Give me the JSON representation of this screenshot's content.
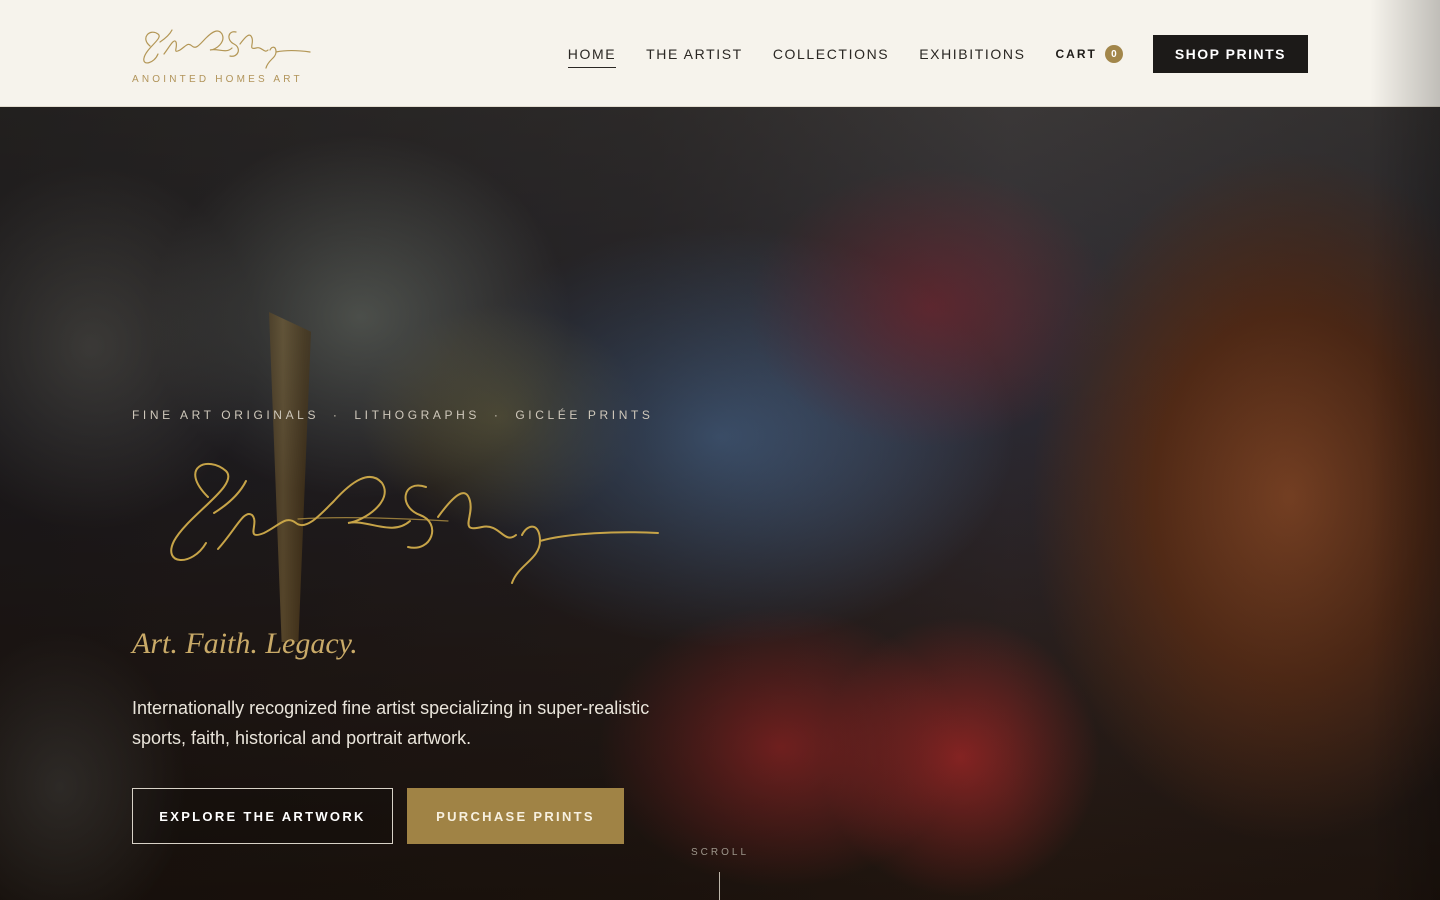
{
  "brand": {
    "signature_name": "Steve R. Skipper",
    "subtitle": "ANOINTED HOMES ART",
    "accent_color": "#a08345"
  },
  "nav": {
    "items": [
      {
        "label": "HOME",
        "active": true
      },
      {
        "label": "THE ARTIST",
        "active": false
      },
      {
        "label": "COLLECTIONS",
        "active": false
      },
      {
        "label": "EXHIBITIONS",
        "active": false
      }
    ],
    "cart_label": "CART",
    "cart_count": "0",
    "shop_label": "SHOP PRINTS"
  },
  "hero": {
    "tagline": "FINE ART ORIGINALS  ·  LITHOGRAPHS  ·  GICLÉE PRINTS",
    "motto": "Art. Faith. Legacy.",
    "description": "Internationally recognized fine artist specializing in super-realistic sports, faith, historical and portrait artwork.",
    "primary_button": "EXPLORE THE ARTWORK",
    "secondary_button": "PURCHASE PRINTS",
    "scroll_label": "SCROLL"
  },
  "icons": {
    "signature": "signature-icon",
    "scroll": "scroll-indicator-line"
  }
}
